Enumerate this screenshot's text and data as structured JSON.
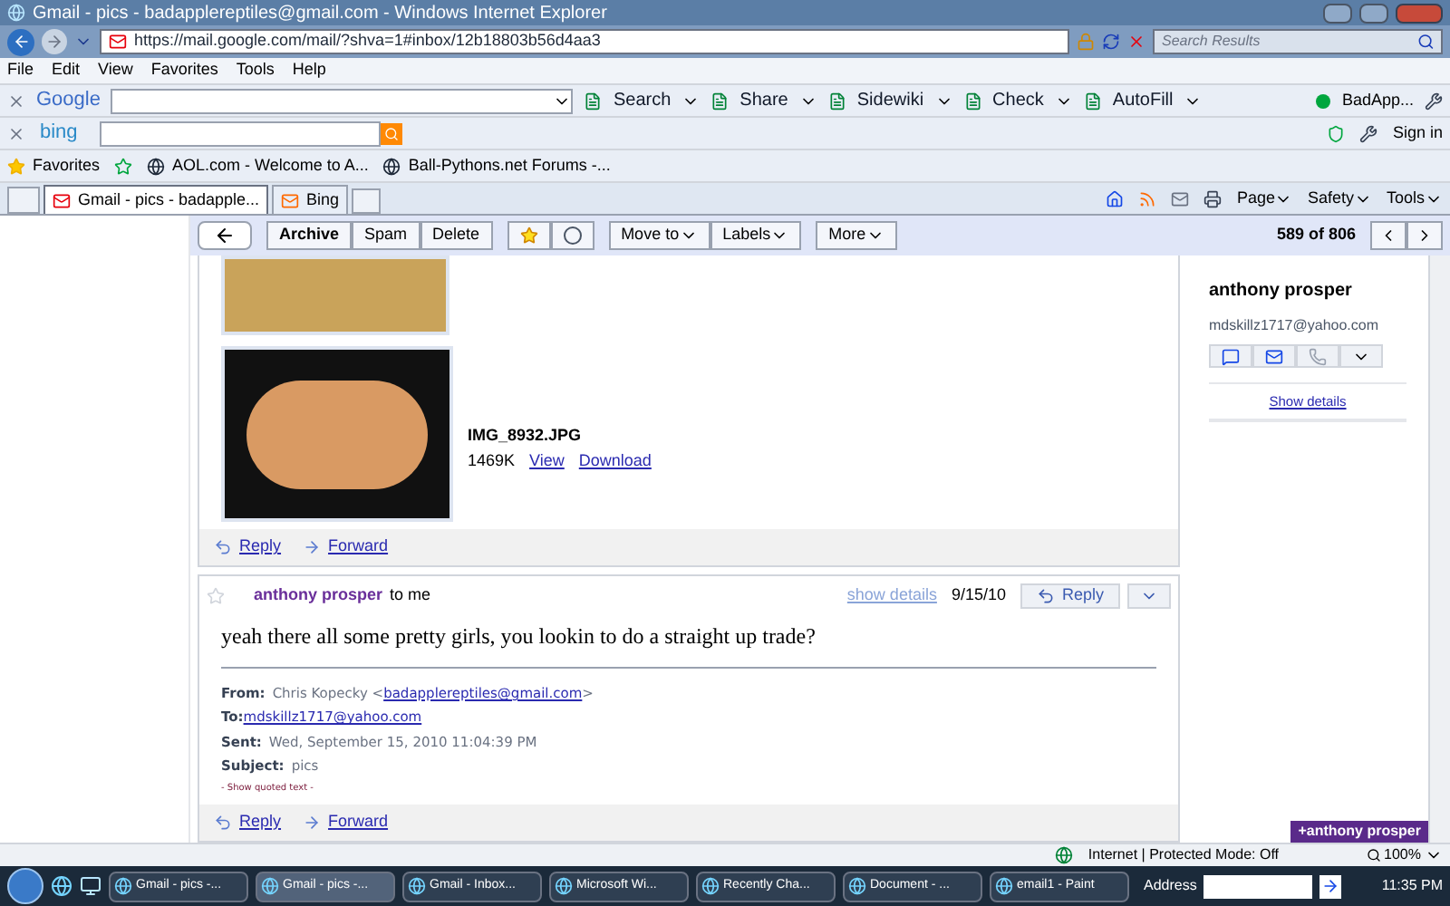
{
  "window": {
    "title": "Gmail - pics - badapplereptiles@gmail.com - Windows Internet Explorer"
  },
  "address_bar": {
    "url": "https://mail.google.com/mail/?shva=1#inbox/12b18803b56d4aa3"
  },
  "search_box": {
    "placeholder": "Search Results"
  },
  "menu": [
    "File",
    "Edit",
    "View",
    "Favorites",
    "Tools",
    "Help"
  ],
  "google_toolbar": {
    "logo": "Google",
    "buttons": [
      "Search",
      "Share",
      "Sidewiki",
      "Check",
      "AutoFill"
    ],
    "account": "BadApp..."
  },
  "bing_toolbar": {
    "logo": "bing",
    "sign_in": "Sign in"
  },
  "favorites": {
    "label": "Favorites",
    "items": [
      "AOL.com - Welcome to A...",
      "Ball-Pythons.net Forums -..."
    ]
  },
  "tabs": [
    {
      "label": "Gmail - pics - badapple...",
      "selected": true
    },
    {
      "label": "Bing",
      "selected": false
    }
  ],
  "command_bar": [
    "Page",
    "Safety",
    "Tools"
  ],
  "gmail_toolbar": {
    "buttons": [
      "Archive",
      "Spam",
      "Delete"
    ],
    "menus": [
      "Move to",
      "Labels",
      "More"
    ],
    "counter": "589 of 806"
  },
  "attachment": {
    "filename": "IMG_8932.JPG",
    "size": "1469K",
    "links": [
      "View",
      "Download"
    ]
  },
  "message_actions": [
    "Reply",
    "Forward"
  ],
  "message": {
    "sender": "anthony prosper",
    "recipient": "to me",
    "show_details": "show details",
    "date": "9/15/10",
    "reply": "Reply",
    "body": "yeah there all some pretty girls, you lookin to do a straight up trade?",
    "quoted": [
      {
        "label": "From:",
        "value": "Chris Kopecky <",
        "link": "badapplereptiles@gmail.com",
        "after": ">"
      },
      {
        "label": "To:",
        "link": "mdskillz1717@yahoo.com"
      },
      {
        "label": "Sent:",
        "value": "Wed, September 15, 2010 11:04:39 PM"
      },
      {
        "label": "Subject:",
        "value": "pics"
      }
    ],
    "show_quoted": "- Show quoted text -",
    "actions": [
      "Reply",
      "Forward"
    ]
  },
  "contact": {
    "name": "anthony prosper",
    "email": "mdskillz1717@yahoo.com",
    "show_details": "Show details"
  },
  "chat_chip": "+anthony prosper",
  "status_bar": {
    "zone": "Internet | Protected Mode: Off",
    "zoom": "100%"
  },
  "taskbar": {
    "items": [
      {
        "label": "Gmail - pics -...",
        "selected": false
      },
      {
        "label": "Gmail - pics -...",
        "selected": true
      },
      {
        "label": "Gmail - Inbox...",
        "selected": false
      },
      {
        "label": "Microsoft Wi...",
        "selected": false
      },
      {
        "label": "Recently Cha...",
        "selected": false
      },
      {
        "label": "Document - ...",
        "selected": false
      },
      {
        "label": "email1 - Paint",
        "selected": false
      }
    ],
    "address_label": "Address",
    "time": "11:35 PM"
  }
}
